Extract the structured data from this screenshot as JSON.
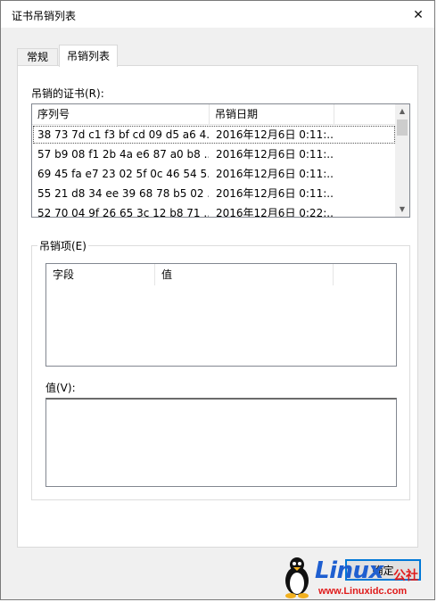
{
  "window": {
    "title": "证书吊销列表"
  },
  "tabs": [
    {
      "label": "常规",
      "active": false
    },
    {
      "label": "吊销列表",
      "active": true
    }
  ],
  "revoked": {
    "label": "吊销的证书(R):",
    "columns": [
      "序列号",
      "吊销日期"
    ],
    "rows": [
      {
        "serial": "38 73 7d c1 f3 bf cd 09 d5 a6 4...",
        "date": "2016年12月6日 0:11:..."
      },
      {
        "serial": "57 b9 08 f1 2b 4a e6 87 a0 b8 ...",
        "date": "2016年12月6日 0:11:..."
      },
      {
        "serial": "69 45 fa e7 23 02 5f 0c 46 54 5...",
        "date": "2016年12月6日 0:11:..."
      },
      {
        "serial": "55 21 d8 34 ee 39 68 78 b5 02 ...",
        "date": "2016年12月6日 0:11:..."
      },
      {
        "serial": "52 70 04 9f 26 65 3c 12 b8 71 ...",
        "date": "2016年12月6日 0:22:..."
      }
    ]
  },
  "entry": {
    "group_title": "吊销项(E)",
    "columns": [
      "字段",
      "值"
    ],
    "value_label": "值(V):"
  },
  "buttons": {
    "ok": "确定"
  },
  "watermark": {
    "brand": "Linux",
    "suffix": "公社",
    "url": "www.Linuxidc.com"
  },
  "colors": {
    "accent": "#0078d7",
    "watermark_blue": "#1f5fd0",
    "watermark_red": "#e01b1b"
  }
}
